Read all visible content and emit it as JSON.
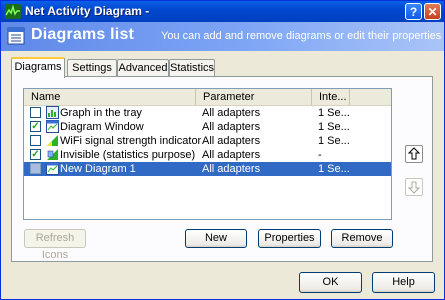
{
  "window": {
    "title": "Net Activity Diagram -"
  },
  "header": {
    "title": "Diagrams list",
    "description": "You can add and remove diagrams or edit their properties"
  },
  "tabs": [
    {
      "label": "Diagrams",
      "active": true
    },
    {
      "label": "Settings",
      "active": false
    },
    {
      "label": "Advanced",
      "active": false
    },
    {
      "label": "Statistics",
      "active": false
    }
  ],
  "list": {
    "columns": [
      "Name",
      "Parameter",
      "Inte..."
    ],
    "rows": [
      {
        "checked": false,
        "name": "Graph in the tray",
        "parameter": "All adapters",
        "interval": "1 Se...",
        "icon": "tray-graph-icon"
      },
      {
        "checked": true,
        "name": "Diagram Window",
        "parameter": "All adapters",
        "interval": "1 Se...",
        "icon": "diagram-window-icon"
      },
      {
        "checked": false,
        "name": "WiFi signal strength indicator",
        "parameter": "All adapters",
        "interval": "1 Se...",
        "icon": "wifi-signal-icon"
      },
      {
        "checked": true,
        "name": "Invisible (statistics purpose)",
        "parameter": "All adapters",
        "interval": "-",
        "icon": "statistics-icon"
      },
      {
        "checked": false,
        "name": "New Diagram 1",
        "parameter": "All adapters",
        "interval": "1 Se...",
        "icon": "diagram-window-icon",
        "selected": true
      }
    ]
  },
  "buttons": {
    "refresh_icons": "Refresh Icons",
    "new": "New",
    "properties": "Properties",
    "remove": "Remove",
    "ok": "OK",
    "help": "Help"
  },
  "colors": {
    "title_bar": "#0348d1",
    "header": "#7ea5f5",
    "selection": "#316ac5",
    "tab_highlight": "#ffc83c"
  }
}
